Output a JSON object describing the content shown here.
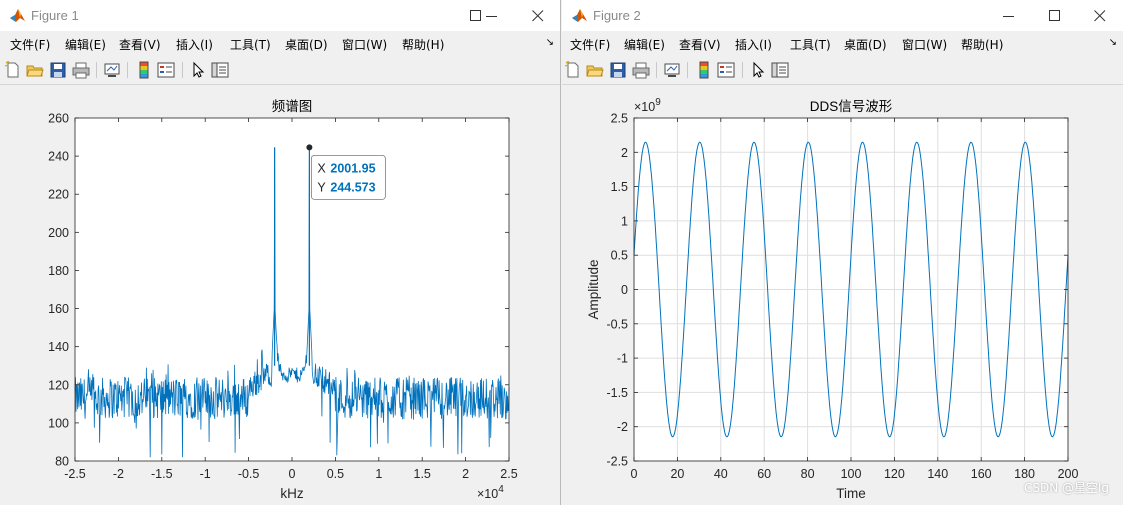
{
  "windows": [
    {
      "title": "Figure 1",
      "menu": [
        "文件(F)",
        "编辑(E)",
        "查看(V)",
        "插入(I)",
        "工具(T)",
        "桌面(D)",
        "窗口(W)",
        "帮助(H)"
      ],
      "more_arrow": "↘",
      "toolbar_icons": [
        "new-figure-icon",
        "open-file-icon",
        "save-icon",
        "print-icon",
        "link-plot-icon",
        "colorbar-icon",
        "legend-icon",
        "pointer-icon",
        "property-inspector-icon"
      ]
    },
    {
      "title": "Figure 2",
      "menu": [
        "文件(F)",
        "编辑(E)",
        "查看(V)",
        "插入(I)",
        "工具(T)",
        "桌面(D)",
        "窗口(W)",
        "帮助(H)"
      ],
      "more_arrow": "↘",
      "toolbar_icons": [
        "new-figure-icon",
        "open-file-icon",
        "save-icon",
        "print-icon",
        "link-plot-icon",
        "colorbar-icon",
        "legend-icon",
        "pointer-icon",
        "property-inspector-icon"
      ]
    }
  ],
  "colors": {
    "series": "#0072bd",
    "datatip_value": "#0072bd",
    "axes": "#262626",
    "grid": "#dfdfdf"
  },
  "chart_data": [
    {
      "type": "line",
      "title": "频谱图",
      "xlabel": "kHz",
      "ylabel": "",
      "xlim": [
        -2.5,
        2.5
      ],
      "ylim": [
        80,
        260
      ],
      "x_exponent": "×10",
      "x_exponent_power": "4",
      "x_ticks": [
        "-2.5",
        "-2",
        "-1.5",
        "-1",
        "-0.5",
        "0",
        "0.5",
        "1",
        "1.5",
        "2",
        "2.5"
      ],
      "y_ticks": [
        "80",
        "100",
        "120",
        "140",
        "160",
        "180",
        "200",
        "220",
        "240",
        "260"
      ],
      "grid": false,
      "noise_floor": 113,
      "peaks": [
        {
          "x": -0.2002,
          "y": 244.573
        },
        {
          "x": 0.2002,
          "y": 244.573
        }
      ],
      "datatip": {
        "x_label": "X",
        "x_value": "2001.95",
        "y_label": "Y",
        "y_value": "244.573",
        "x": 0.2002,
        "y": 244.573
      }
    },
    {
      "type": "line",
      "title": "DDS信号波形",
      "xlabel": "Time",
      "ylabel": "Amplitude",
      "xlim": [
        0,
        200
      ],
      "ylim": [
        -2.5,
        2.5
      ],
      "y_exponent": "×10",
      "y_exponent_power": "9",
      "x_ticks": [
        "0",
        "20",
        "40",
        "60",
        "80",
        "100",
        "120",
        "140",
        "160",
        "180",
        "200"
      ],
      "y_ticks": [
        "-2.5",
        "-2",
        "-1.5",
        "-1",
        "-0.5",
        "0",
        "0.5",
        "1",
        "1.5",
        "2",
        "2.5"
      ],
      "grid": true,
      "amplitude": 2.147,
      "period": 25,
      "phase_start_value": 0.5
    }
  ],
  "watermark": "CSDN @星空lg"
}
